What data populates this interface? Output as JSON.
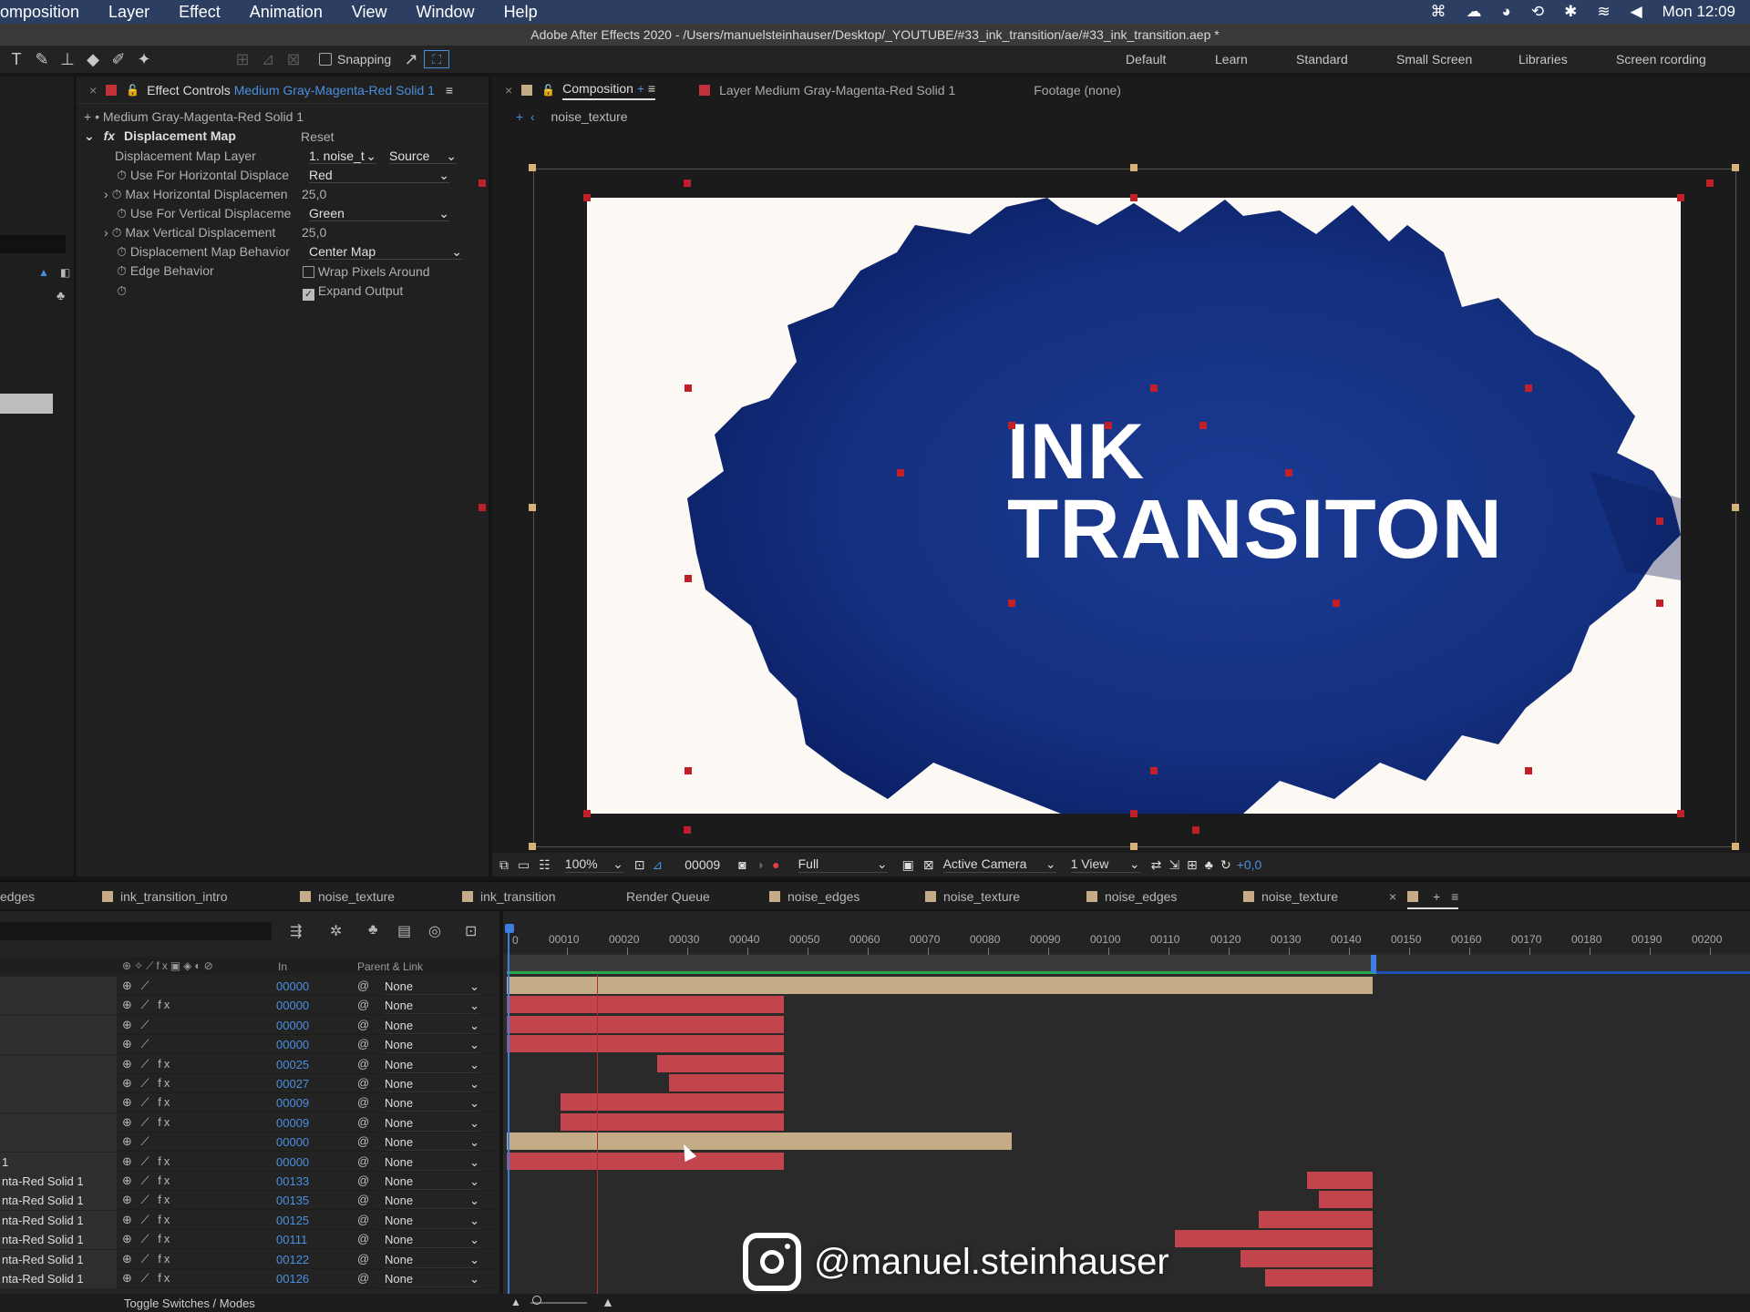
{
  "menubar": {
    "items": [
      "omposition",
      "Layer",
      "Effect",
      "Animation",
      "View",
      "Window",
      "Help"
    ],
    "clock": "Mon 12:09"
  },
  "titlebar": {
    "title": "Adobe After Effects 2020 - /Users/manuelsteinhauser/Desktop/_YOUTUBE/#33_ink_transition/ae/#33_ink_transition.aep *"
  },
  "toolbar": {
    "snapping": "Snapping",
    "workspaces": [
      "Default",
      "Learn",
      "Standard",
      "Small Screen",
      "Libraries",
      "Screen rcording"
    ]
  },
  "effect_controls": {
    "tab_label": "Effect Controls",
    "tab_layer": "Medium Gray-Magenta-Red Solid 1",
    "layer_line": "• Medium Gray-Magenta-Red Solid 1",
    "effect_name": "Displacement Map",
    "reset": "Reset",
    "props": [
      {
        "label": "Displacement Map Layer",
        "value": "1. noise_t",
        "value2": "Source"
      },
      {
        "label": "Use For Horizontal Displace",
        "value": "Red"
      },
      {
        "label": "Max Horizontal Displacemen",
        "value": "25,0"
      },
      {
        "label": "Use For Vertical Displaceme",
        "value": "Green"
      },
      {
        "label": "Max Vertical Displacement",
        "value": "25,0"
      },
      {
        "label": "Displacement Map Behavior",
        "value": "Center Map"
      },
      {
        "label": "Edge Behavior",
        "value": "Wrap Pixels Around"
      },
      {
        "label": "",
        "value": "Expand Output"
      }
    ]
  },
  "composition": {
    "tab_label": "Composition",
    "layer_tab": "Layer Medium Gray-Magenta-Red Solid 1",
    "footage_tab": "Footage (none)",
    "breadcrumb": "noise_texture",
    "text_line1": "INK",
    "text_line2": "TRANSITON",
    "ink_color": "#0f2a78"
  },
  "viewer": {
    "zoom": "100%",
    "frame": "00009",
    "resolution": "Full",
    "camera": "Active Camera",
    "views": "1 View",
    "exposure": "+0,0"
  },
  "panel_tabs": [
    "edges",
    "ink_transition_intro",
    "noise_texture",
    "ink_transition",
    "Render Queue",
    "noise_edges",
    "noise_texture",
    "noise_edges",
    "noise_texture"
  ],
  "timeline": {
    "header_in": "In",
    "header_parent": "Parent & Link",
    "ruler": [
      "00010",
      "00020",
      "00030",
      "00040",
      "00050",
      "00060",
      "00070",
      "00080",
      "00090",
      "00100",
      "00110",
      "00120",
      "00130",
      "00140",
      "00150",
      "00160",
      "00170",
      "00180",
      "00190",
      "00200"
    ],
    "playhead_label": "0",
    "layers": [
      {
        "name": "",
        "in": "00000",
        "parent": "None",
        "fx": false,
        "start": 0,
        "end": 144,
        "color": "tan"
      },
      {
        "name": "",
        "in": "00000",
        "parent": "None",
        "fx": true,
        "start": 0,
        "end": 46,
        "color": "red"
      },
      {
        "name": "",
        "in": "00000",
        "parent": "None",
        "fx": false,
        "start": 0,
        "end": 46,
        "color": "red"
      },
      {
        "name": "",
        "in": "00000",
        "parent": "None",
        "fx": false,
        "start": 0,
        "end": 46,
        "color": "red"
      },
      {
        "name": "",
        "in": "00025",
        "parent": "None",
        "fx": true,
        "start": 25,
        "end": 46,
        "color": "red"
      },
      {
        "name": "",
        "in": "00027",
        "parent": "None",
        "fx": true,
        "start": 27,
        "end": 46,
        "color": "red"
      },
      {
        "name": "",
        "in": "00009",
        "parent": "None",
        "fx": true,
        "start": 9,
        "end": 46,
        "color": "red"
      },
      {
        "name": "",
        "in": "00009",
        "parent": "None",
        "fx": true,
        "start": 9,
        "end": 46,
        "color": "red"
      },
      {
        "name": "",
        "in": "00000",
        "parent": "None",
        "fx": false,
        "start": 0,
        "end": 84,
        "color": "tan"
      },
      {
        "name": "1",
        "in": "00000",
        "parent": "None",
        "fx": true,
        "start": 0,
        "end": 46,
        "color": "red"
      },
      {
        "name": "nta-Red Solid 1",
        "in": "00133",
        "parent": "None",
        "fx": true,
        "start": 133,
        "end": 144,
        "color": "red"
      },
      {
        "name": "nta-Red Solid 1",
        "in": "00135",
        "parent": "None",
        "fx": true,
        "start": 135,
        "end": 144,
        "color": "red"
      },
      {
        "name": "nta-Red Solid 1",
        "in": "00125",
        "parent": "None",
        "fx": true,
        "start": 125,
        "end": 144,
        "color": "red"
      },
      {
        "name": "nta-Red Solid 1",
        "in": "00111",
        "parent": "None",
        "fx": true,
        "start": 111,
        "end": 144,
        "color": "red"
      },
      {
        "name": "nta-Red Solid 1",
        "in": "00122",
        "parent": "None",
        "fx": true,
        "start": 122,
        "end": 144,
        "color": "red"
      },
      {
        "name": "nta-Red Solid 1",
        "in": "00126",
        "parent": "None",
        "fx": true,
        "start": 126,
        "end": 144,
        "color": "red"
      }
    ]
  },
  "bottom": {
    "toggle": "Toggle Switches / Modes"
  },
  "watermark": {
    "handle": "@manuel.steinhauser"
  },
  "colors": {
    "bar_red": "#c2454d",
    "bar_tan": "#c4ad86",
    "accent_blue": "#4a8fe0"
  }
}
